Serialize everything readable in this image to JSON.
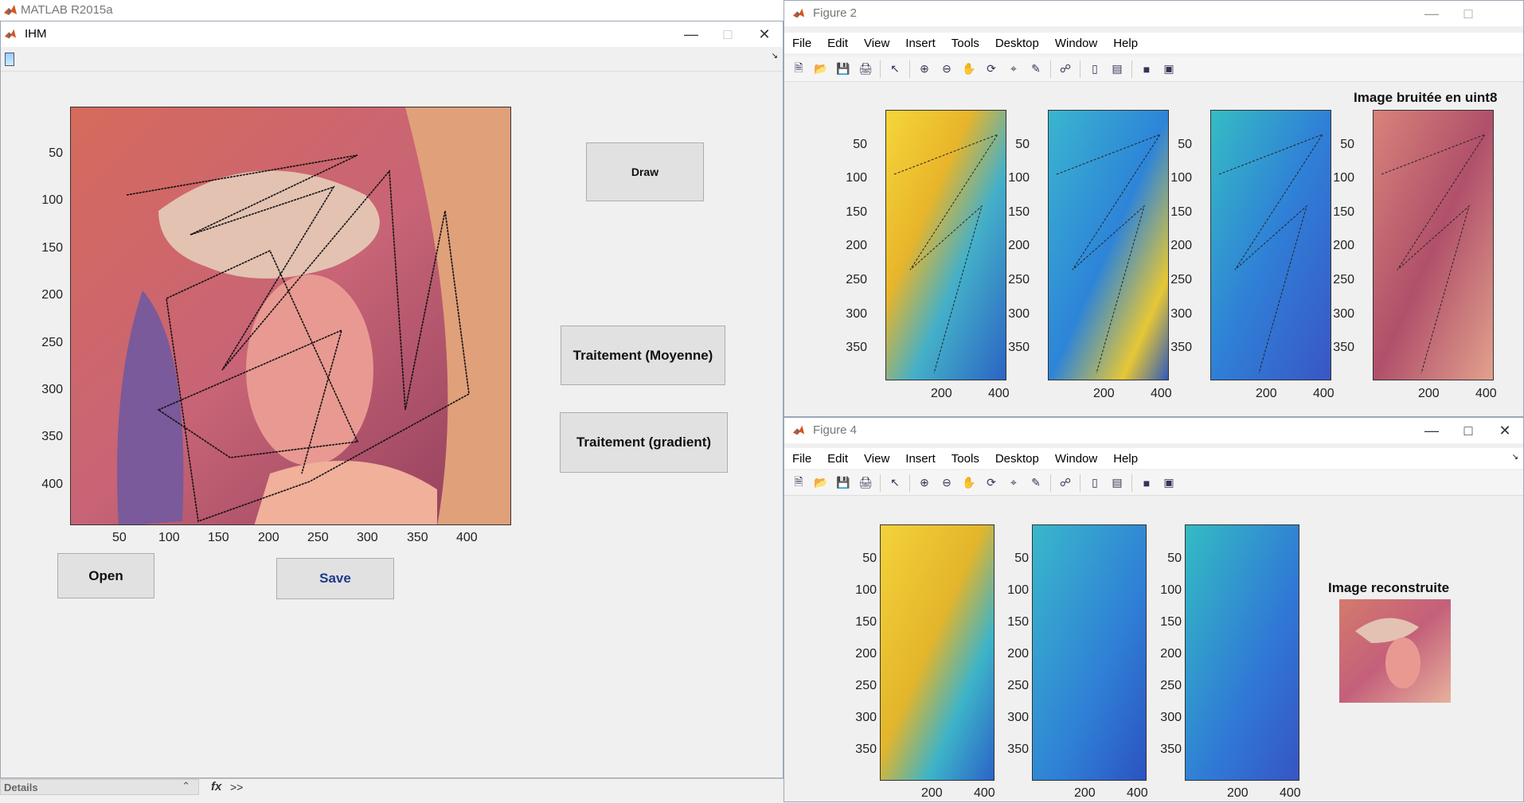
{
  "matlab": {
    "title": "MATLAB R2015a"
  },
  "ihm": {
    "title": "IHM",
    "buttons": {
      "draw": "Draw",
      "moyenne": "Traitement (Moyenne)",
      "gradient": "Traitement (gradient)",
      "open": "Open",
      "save": "Save"
    },
    "yticks": [
      "50",
      "100",
      "150",
      "200",
      "250",
      "300",
      "350",
      "400"
    ],
    "xticks": [
      "50",
      "100",
      "150",
      "200",
      "250",
      "300",
      "350",
      "400"
    ]
  },
  "fig2": {
    "title": "Figure 2",
    "menu": [
      "File",
      "Edit",
      "View",
      "Insert",
      "Tools",
      "Desktop",
      "Window",
      "Help"
    ],
    "image_title": "Image bruitée en uint8",
    "yticks": [
      "50",
      "100",
      "150",
      "200",
      "250",
      "300",
      "350"
    ],
    "xticks": [
      "200",
      "400"
    ]
  },
  "fig4": {
    "title": "Figure 4",
    "menu": [
      "File",
      "Edit",
      "View",
      "Insert",
      "Tools",
      "Desktop",
      "Window",
      "Help"
    ],
    "image_title": "Image reconstruite",
    "yticks": [
      "50",
      "100",
      "150",
      "200",
      "250",
      "300",
      "350"
    ],
    "xticks": [
      "200",
      "400"
    ]
  },
  "bottom": {
    "details": "Details",
    "fx": "fx",
    "prompt": ">>"
  },
  "colors": {
    "parula_blue": "#2a7fd6",
    "parula_yellow": "#f2c522",
    "lena_rose": "#c4607a"
  },
  "icons": [
    "matlab-logo-icon",
    "minimize-icon",
    "maximize-icon",
    "close-icon",
    "new-file-icon",
    "open-folder-icon",
    "save-icon",
    "print-icon",
    "pointer-icon",
    "zoom-in-icon",
    "zoom-out-icon",
    "pan-icon",
    "rotate-icon",
    "data-cursor-icon",
    "brush-icon",
    "link-icon",
    "colorbar-icon",
    "legend-icon",
    "hide-tools-icon",
    "dock-icon"
  ]
}
